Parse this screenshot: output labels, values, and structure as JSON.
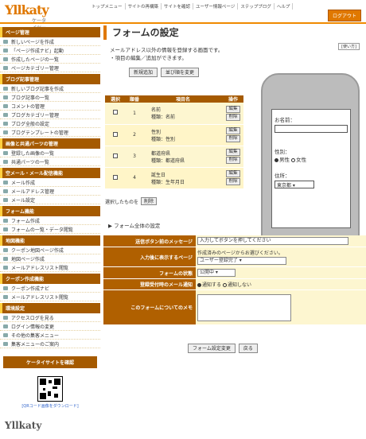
{
  "header": {
    "logo": "Yllkaty",
    "logo_sub": "ケータイツール",
    "nav": [
      "トップメニュー",
      "サイトの再構築",
      "サイトを確認",
      "ユーザー情報ページ",
      "ステップブログ",
      "ヘルプ"
    ],
    "logout": "ログアウト"
  },
  "sidebar": [
    {
      "title": "ページ管理",
      "items": [
        "新しいページを作成",
        "「ページ作成ナビ」起動",
        "作成したページの一覧",
        "ページカテゴリー管理"
      ]
    },
    {
      "title": "ブログ記事管理",
      "items": [
        "新しいブログ記事を作成",
        "ブログ記事の一覧",
        "コメントの管理",
        "ブログカテゴリー管理",
        "ブログ全般の設定",
        "ブログテンプレートの管理"
      ]
    },
    {
      "title": "画像と共通パーツの管理",
      "items": [
        "登録した画像の一覧",
        "共通パーツの一覧"
      ]
    },
    {
      "title": "空メール・メール配信機能",
      "items": [
        "メール作成",
        "メールアドレス管理",
        "メール設定"
      ]
    },
    {
      "title": "フォーム機能",
      "items": [
        "フォーム作成",
        "フォームの一覧・データ閲覧"
      ]
    },
    {
      "title": "地図機能",
      "items": [
        "クーポン地図ページ作成",
        "地図ページ作成",
        "メールアドレスリスト閲覧"
      ]
    },
    {
      "title": "クーポン作成機能",
      "items": [
        "クーポン作成ナビ",
        "メールアドレスリスト閲覧"
      ]
    },
    {
      "title": "環境設定",
      "items": [
        "アクセスログを見る",
        "ログイン情報の変更",
        "その他の集客メニュー",
        "集客メニューのご案内"
      ]
    }
  ],
  "mobile": {
    "title": "ケータイサイトを確認",
    "qr_link": "[QRコード画像をダウンロード]",
    "bottom_logo": "Yllkaty"
  },
  "main": {
    "title": "フォームの設定",
    "help": "[使い方]",
    "desc1": "メールアドレス以外の情報を登録する画面です。",
    "desc2": "・項目の編集／追加ができます。",
    "add_btn": "新規追加",
    "sort_btn": "並び順を変更",
    "headers": [
      "選択",
      "順番",
      "項目名",
      "操作"
    ],
    "rows": [
      {
        "num": "1",
        "name": "名前",
        "type": "種類：名前"
      },
      {
        "num": "2",
        "name": "性別",
        "type": "種類：性別"
      },
      {
        "num": "3",
        "name": "都道府県",
        "type": "種類：都道府県"
      },
      {
        "num": "4",
        "name": "誕生日",
        "type": "種類：生年月日"
      }
    ],
    "edit": "編集",
    "del": "削除",
    "selected_label": "選択したものを",
    "selected_del": "削除"
  },
  "phone": {
    "name_label": "お名前：",
    "sex_label": "性別：",
    "male": "男性",
    "female": "女性",
    "addr_label": "住所：",
    "pref": "東京都"
  },
  "settings": {
    "title": "フォーム全体の設定",
    "rows": [
      {
        "label": "送信ボタン前のメッセージ",
        "value": "入力してボタンを押してください"
      },
      {
        "label": "入力後に表示するページ",
        "note": "作成済みのページからお選びください。",
        "value": "ユーザー登録完了"
      },
      {
        "label": "フォームの状態",
        "value": "公開中"
      },
      {
        "label": "登録受付時のメール通知",
        "opt1": "通知する",
        "opt2": "通知しない"
      },
      {
        "label": "このフォームについてのメモ",
        "value": ""
      }
    ],
    "save": "フォーム設定変更",
    "back": "戻る"
  }
}
